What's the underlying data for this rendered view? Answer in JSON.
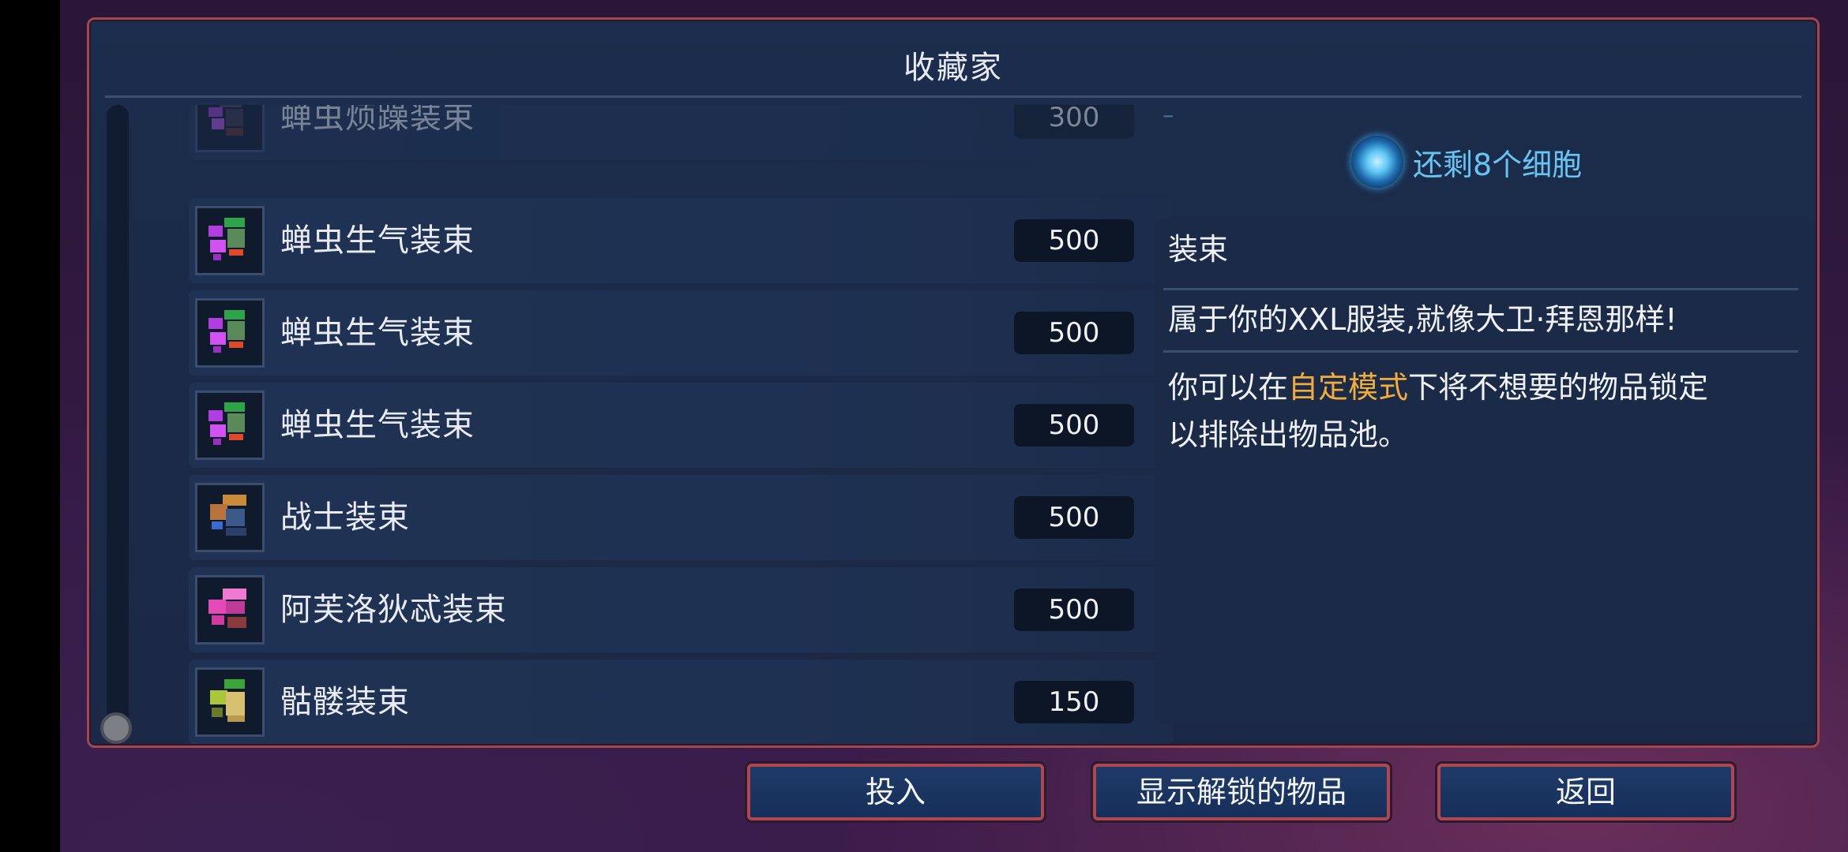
{
  "title": "收藏家",
  "cells_remaining": "还剩8个细胞",
  "items": [
    {
      "name": "蝉虫烦躁装束",
      "cost": "300",
      "faded": true,
      "icon": "purple-outfit-icon"
    },
    {
      "name": "蝉虫生气装束",
      "cost": "500",
      "faded": false,
      "icon": "purple-green-outfit-icon"
    },
    {
      "name": "蝉虫生气装束",
      "cost": "500",
      "faded": false,
      "icon": "purple-green-outfit-icon"
    },
    {
      "name": "蝉虫生气装束",
      "cost": "500",
      "faded": false,
      "icon": "purple-green-outfit-icon"
    },
    {
      "name": "战士装束",
      "cost": "500",
      "faded": false,
      "icon": "warrior-outfit-icon"
    },
    {
      "name": "阿芙洛狄忒装束",
      "cost": "500",
      "faded": false,
      "icon": "pink-outfit-icon"
    },
    {
      "name": "骷髅装束",
      "cost": "150",
      "faded": false,
      "icon": "skeleton-outfit-icon"
    }
  ],
  "plus_symbol": "+",
  "description": {
    "heading": "装束",
    "line1": "属于你的XXL服装,就像大卫·拜恩那样!",
    "line2_prefix": "你可以在",
    "line2_highlight": "自定模式",
    "line2_suffix": "下将不想要的物品锁定",
    "line3": "以排除出物品池。"
  },
  "buttons": {
    "invest": "投入",
    "show_unlocked": "显示解锁的物品",
    "back": "返回"
  },
  "colors": {
    "accent_blue": "#6cc6f4",
    "highlight_orange": "#f0ad3c",
    "border_red": "#a2474e"
  }
}
